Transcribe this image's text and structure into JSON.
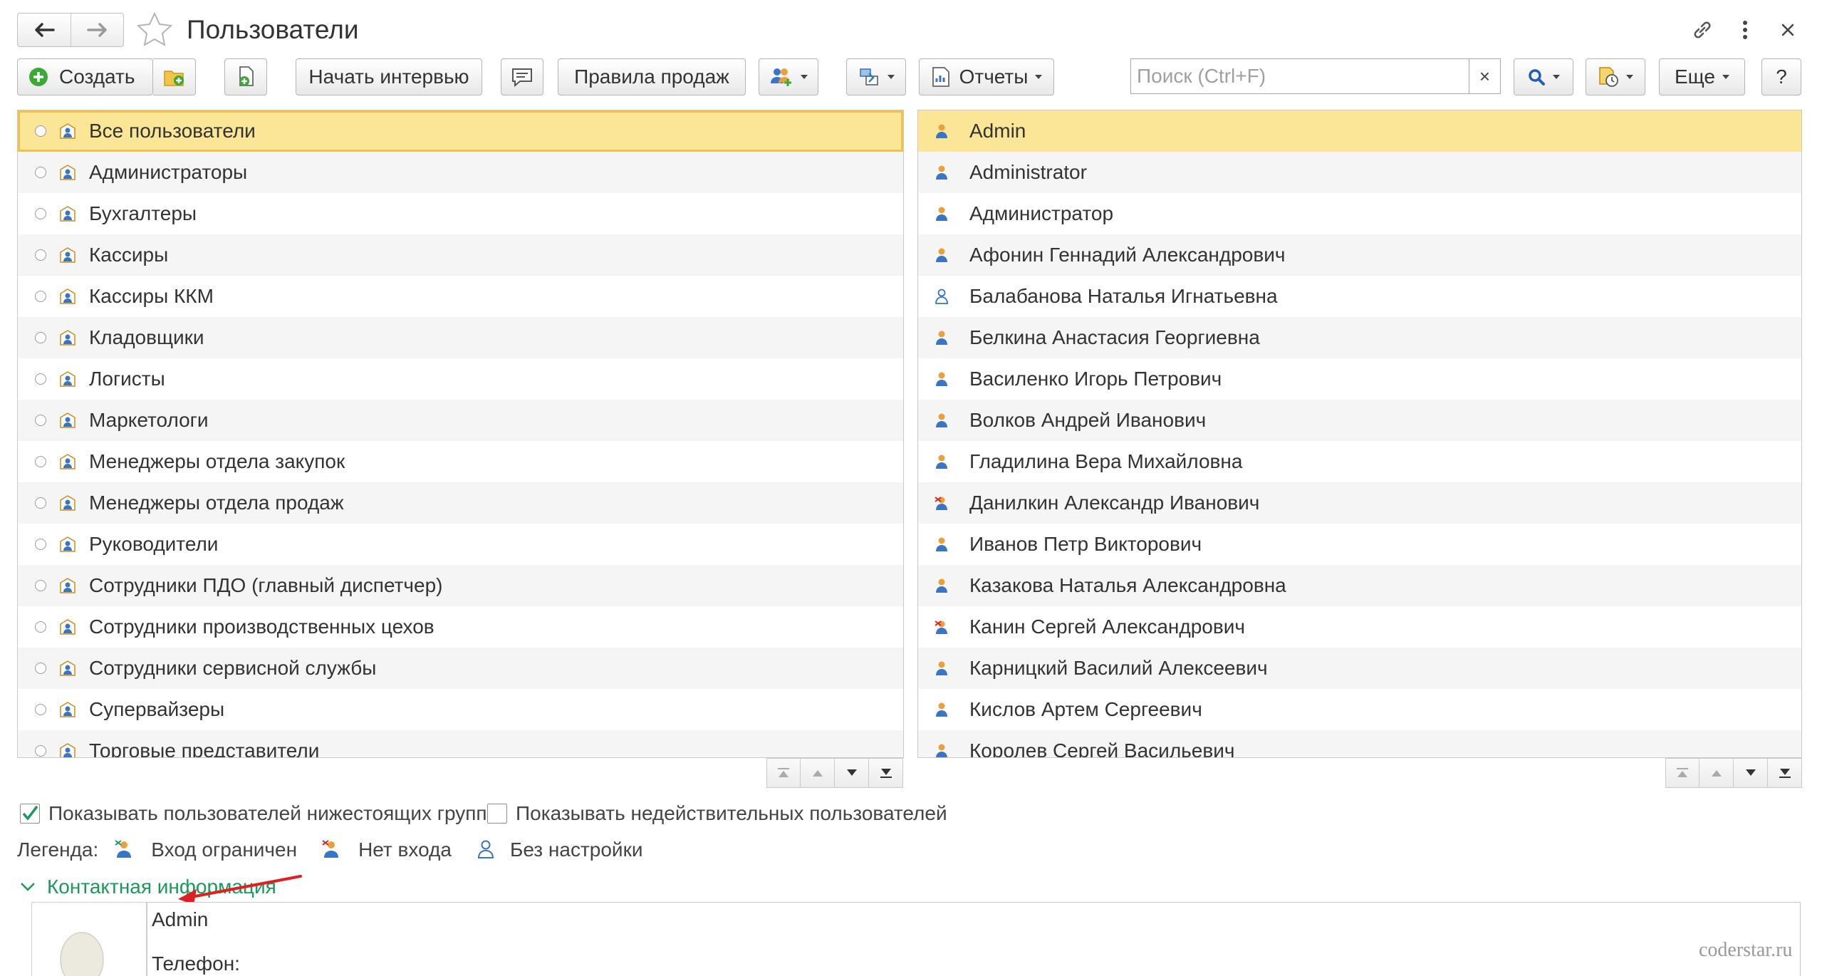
{
  "window": {
    "title": "Пользователи"
  },
  "toolbar": {
    "create_label": "Создать",
    "start_interview_label": "Начать интервью",
    "sales_rules_label": "Правила продаж",
    "reports_label": "Отчеты",
    "more_label": "Еще",
    "help_label": "?"
  },
  "search": {
    "placeholder": "Поиск (Ctrl+F)",
    "clear_label": "×"
  },
  "groups": {
    "items": [
      {
        "label": "Все пользователи"
      },
      {
        "label": "Администраторы"
      },
      {
        "label": "Бухгалтеры"
      },
      {
        "label": "Кассиры"
      },
      {
        "label": "Кассиры ККМ"
      },
      {
        "label": "Кладовщики"
      },
      {
        "label": "Логисты"
      },
      {
        "label": "Маркетологи"
      },
      {
        "label": "Менеджеры отдела закупок"
      },
      {
        "label": "Менеджеры отдела продаж"
      },
      {
        "label": "Руководители"
      },
      {
        "label": "Сотрудники ПДО (главный диспетчер)"
      },
      {
        "label": "Сотрудники производственных цехов"
      },
      {
        "label": "Сотрудники сервисной службы"
      },
      {
        "label": "Супервайзеры"
      },
      {
        "label": "Торговые представители"
      }
    ]
  },
  "users": {
    "items": [
      {
        "label": "Admin",
        "status": "normal"
      },
      {
        "label": "Administrator",
        "status": "normal"
      },
      {
        "label": "Администратор",
        "status": "normal"
      },
      {
        "label": "Афонин Геннадий Александрович",
        "status": "normal"
      },
      {
        "label": "Балабанова Наталья Игнатьевна",
        "status": "no-setup"
      },
      {
        "label": "Белкина Анастасия Георгиевна",
        "status": "normal"
      },
      {
        "label": "Василенко Игорь Петрович",
        "status": "normal"
      },
      {
        "label": "Волков Андрей Иванович",
        "status": "normal"
      },
      {
        "label": "Гладилина Вера Михайловна",
        "status": "normal"
      },
      {
        "label": "Данилкин Александр Иванович",
        "status": "no-login"
      },
      {
        "label": "Иванов Петр Викторович",
        "status": "normal"
      },
      {
        "label": "Казакова Наталья Александровна",
        "status": "normal"
      },
      {
        "label": "Канин Сергей Александрович",
        "status": "no-login"
      },
      {
        "label": "Карницкий Василий Алексеевич",
        "status": "normal"
      },
      {
        "label": "Кислов Артем Сергеевич",
        "status": "normal"
      },
      {
        "label": "Королев Сергей Васильевич",
        "status": "normal"
      }
    ]
  },
  "options": {
    "show_subgroup_users": "Показывать пользователей нижестоящих групп",
    "show_subgroup_users_checked": true,
    "show_invalid_users": "Показывать недействительных пользователей",
    "show_invalid_users_checked": false
  },
  "legend": {
    "title": "Легенда:",
    "limited": "Вход ограничен",
    "no_login": "Нет входа",
    "no_setup": "Без настройки"
  },
  "contact": {
    "header": "Контактная информация",
    "name": "Admin",
    "phone_label": "Телефон:"
  },
  "watermark": "coderstar.ru",
  "colors": {
    "selection": "#fbe596",
    "selection_border": "#f0c24a",
    "create_icon": "#3aaa35",
    "section_header": "#1a9a5a",
    "annotation_arrow": "#e02020"
  }
}
